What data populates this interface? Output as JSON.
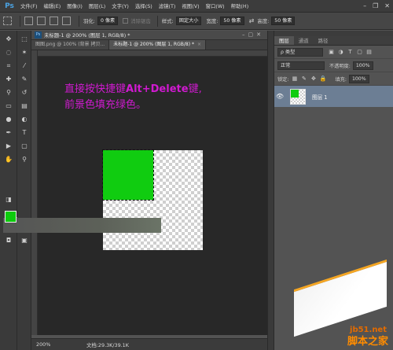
{
  "app": {
    "logo": "Ps"
  },
  "menu": [
    "文件(F)",
    "编辑(E)",
    "图像(I)",
    "图层(L)",
    "文字(Y)",
    "选择(S)",
    "滤镜(T)",
    "视图(V)",
    "窗口(W)",
    "帮助(H)"
  ],
  "options": {
    "feather_label": "羽化:",
    "feather_value": "0 像素",
    "antialias_label": "消除锯齿",
    "style_label": "样式:",
    "style_value": "固定大小",
    "width_label": "宽度:",
    "width_value": "50 像素",
    "height_label": "高度:",
    "height_value": "50 像素"
  },
  "document": {
    "title": "未标题-1 @ 200% (图层 1, RGB/8) *",
    "tab1": "图图.png @ 100% (背景 拷贝...",
    "tab2": "未标题-1 @ 200% (图层 1, RGB/8) *"
  },
  "instruction": {
    "line1_prefix": "直接按快捷键",
    "line1_keys": "Alt+Delete",
    "line1_suffix": "键,",
    "line2": "前景色填充绿色。"
  },
  "status": {
    "zoom": "200%",
    "doc": "文档:29.3K/39.1K"
  },
  "colors": {
    "foreground": "#0dcb0d",
    "background": "#ffffff",
    "accent": "#d01ad0"
  },
  "panel": {
    "tabs": [
      "图层",
      "通道",
      "路径"
    ],
    "kind_label": "ρ 类型",
    "blend_mode": "正常",
    "opacity_label": "不透明度:",
    "opacity_value": "100%",
    "lock_label": "锁定:",
    "fill_label": "填充:",
    "fill_value": "100%",
    "layer_name": "图层 1"
  },
  "watermark": {
    "site": "jb51.net",
    "name": "脚本之家"
  }
}
